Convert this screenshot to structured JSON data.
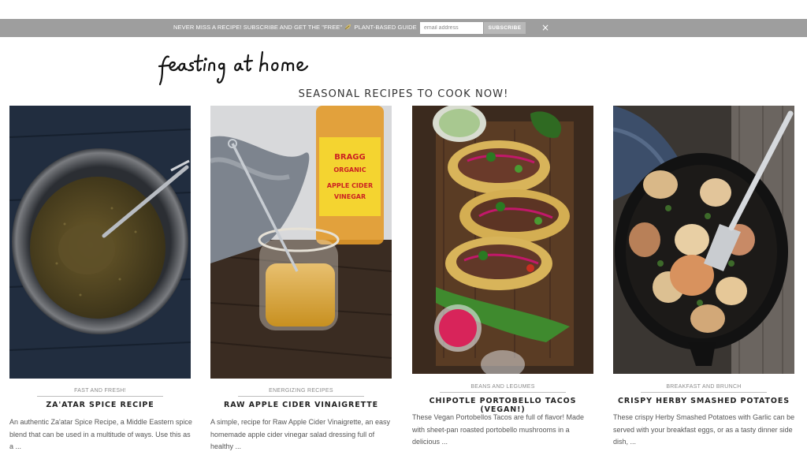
{
  "subscribe_bar": {
    "message_prefix": "NEVER MISS A RECIPE! SUBSCRIBE AND GET THE \"FREE\"",
    "message_suffix": "PLANT-BASED GUIDE",
    "email_placeholder": "email address",
    "email_value": "",
    "button_label": "SUBSCRIBE",
    "close_glyph": "×"
  },
  "logo": {
    "text": "feasting at home"
  },
  "section_heading": "SEASONAL RECIPES TO COOK NOW!",
  "recipes": [
    {
      "category": "FAST AND FRESH!",
      "title": "ZA'ATAR SPICE RECIPE",
      "excerpt": "An authentic Za'atar Spice Recipe, a Middle Eastern spice blend that can be used in a multitude of ways. Use this as a ..."
    },
    {
      "category": "ENERGIZING RECIPES",
      "title": "RAW APPLE CIDER VINAIGRETTE",
      "excerpt": "A simple, recipe for Raw Apple Cider Vinaigrette, an easy homemade apple cider vinegar salad dressing full of healthy ..."
    },
    {
      "category": "BEANS AND LEGUMES",
      "title": "CHIPOTLE PORTOBELLO TACOS (VEGAN!)",
      "excerpt": "These Vegan Portobellos Tacos are full of flavor! Made with sheet-pan roasted portobello mushrooms in a delicious ..."
    },
    {
      "category": "BREAKFAST AND BRUNCH",
      "title": "CRISPY HERBY SMASHED POTATOES",
      "excerpt": "These crispy Herby Smashed Potatoes with Garlic can be served with your breakfast eggs, or as a tasty dinner side dish, ..."
    }
  ],
  "bottle_label": {
    "brand": "BRAGG",
    "line1": "ORGANIC",
    "line2": "APPLE CIDER",
    "line3": "VINEGAR"
  },
  "colors": {
    "topbar": "#9e9e9e",
    "subscribe_button": "#b8b8b8",
    "text_dark": "#222222"
  }
}
